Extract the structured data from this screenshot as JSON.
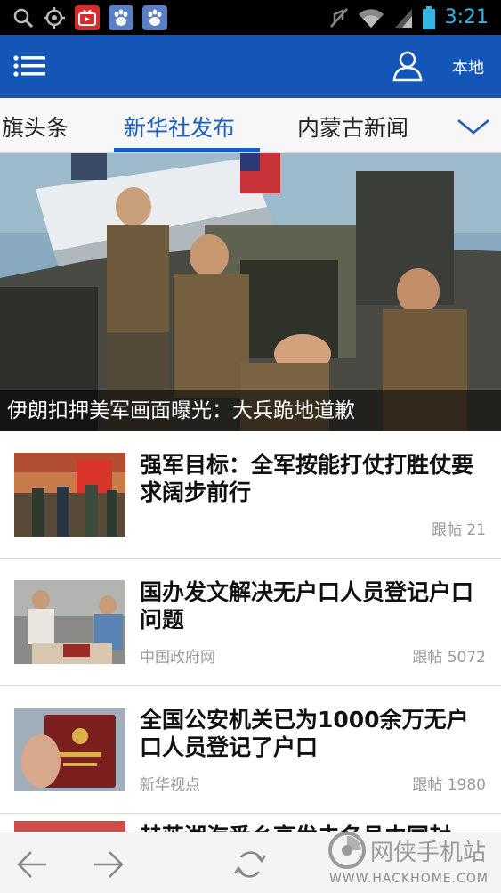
{
  "status_bar": {
    "time": "3:21",
    "icons": [
      "search-icon",
      "gps-icon",
      "tv-app-icon",
      "baidu-icon",
      "baidu-icon",
      "mute-icon",
      "wifi-icon",
      "signal-icon",
      "battery-icon"
    ]
  },
  "header": {
    "menu_icon": "list-menu-icon",
    "user_icon": "user-icon",
    "local_label": "本地",
    "bg_color": "#1455b8"
  },
  "tabs": {
    "items": [
      {
        "label": "旗头条",
        "active": false
      },
      {
        "label": "新华社发布",
        "active": true
      },
      {
        "label": "内蒙古新闻",
        "active": false
      }
    ],
    "more_icon": "chevron-down-icon",
    "accent_color": "#1a5cc0"
  },
  "hero": {
    "caption": "伊朗扣押美军画面曝光：大兵跪地道歉"
  },
  "news": [
    {
      "title": "强军目标：全军按能打仗打胜仗要求阔步前行",
      "source": "",
      "comments": "跟帖 21"
    },
    {
      "title": "国办发文解决无户口人员登记户口问题",
      "source": "中国政府网",
      "comments": "跟帖 5072"
    },
    {
      "title": "全国公安机关已为1000余万无户口人员登记了户口",
      "source": "新华视点",
      "comments": "跟帖 1980"
    }
  ],
  "partial_item": {
    "title": "赫茨湖海番乡亭发去名县中国封"
  },
  "bottom_bar": {
    "icons": [
      "back-arrow-icon",
      "forward-arrow-icon",
      "refresh-icon"
    ]
  },
  "watermark": {
    "name": "网侠手机站",
    "url": "WWW.HACKHOME.COM"
  }
}
